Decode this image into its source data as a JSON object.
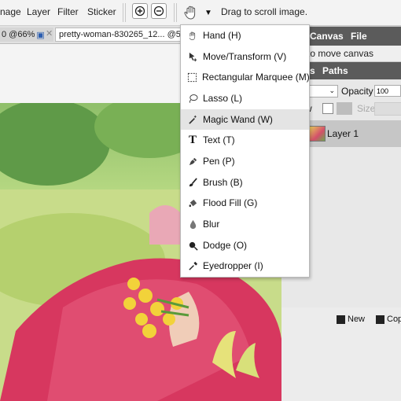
{
  "menu": {
    "items": [
      "nage",
      "Layer",
      "Filter",
      "Sticker"
    ]
  },
  "toolbar": {
    "zoom_in_icon": "zoom-in-icon",
    "zoom_out_icon": "zoom-out-icon",
    "current_tool_icon": "hand-icon",
    "hint": "Drag to scroll image."
  },
  "tabs": [
    {
      "label": "0 @66%"
    },
    {
      "label": "pretty-woman-830265_12... @5"
    }
  ],
  "tool_menu": {
    "items": [
      {
        "label": "Hand (H)",
        "icon": "hand-icon"
      },
      {
        "label": "Move/Transform (V)",
        "icon": "move-icon"
      },
      {
        "label": "Rectangular Marquee (M)",
        "icon": "marquee-icon"
      },
      {
        "label": "Lasso (L)",
        "icon": "lasso-icon"
      },
      {
        "label": "Magic Wand (W)",
        "icon": "magic-wand-icon",
        "selected": true
      },
      {
        "label": "Text (T)",
        "icon": "text-icon"
      },
      {
        "label": "Pen (P)",
        "icon": "pen-icon"
      },
      {
        "label": "Brush (B)",
        "icon": "brush-icon"
      },
      {
        "label": "Flood Fill (G)",
        "icon": "flood-fill-icon"
      },
      {
        "label": "Blur",
        "icon": "blur-icon"
      },
      {
        "label": "Dodge (O)",
        "icon": "dodge-icon"
      },
      {
        "label": "Eyedropper (I)",
        "icon": "eyedropper-icon"
      }
    ]
  },
  "navigator": {
    "tabs": [
      "Canvas",
      "File"
    ],
    "hint": "to move canvas"
  },
  "layers": {
    "tabs": [
      "s",
      "Paths"
    ],
    "opacity_label": "Opacity",
    "opacity_value": "100",
    "lock_label": "w",
    "size_label": "Size",
    "layer_name": "Layer 1",
    "new_button": "New",
    "copy_button": "Cop"
  },
  "colors": {
    "panel_header": "#5b5b5b",
    "dress": "#d7375f",
    "grass": "#b8d57a"
  }
}
